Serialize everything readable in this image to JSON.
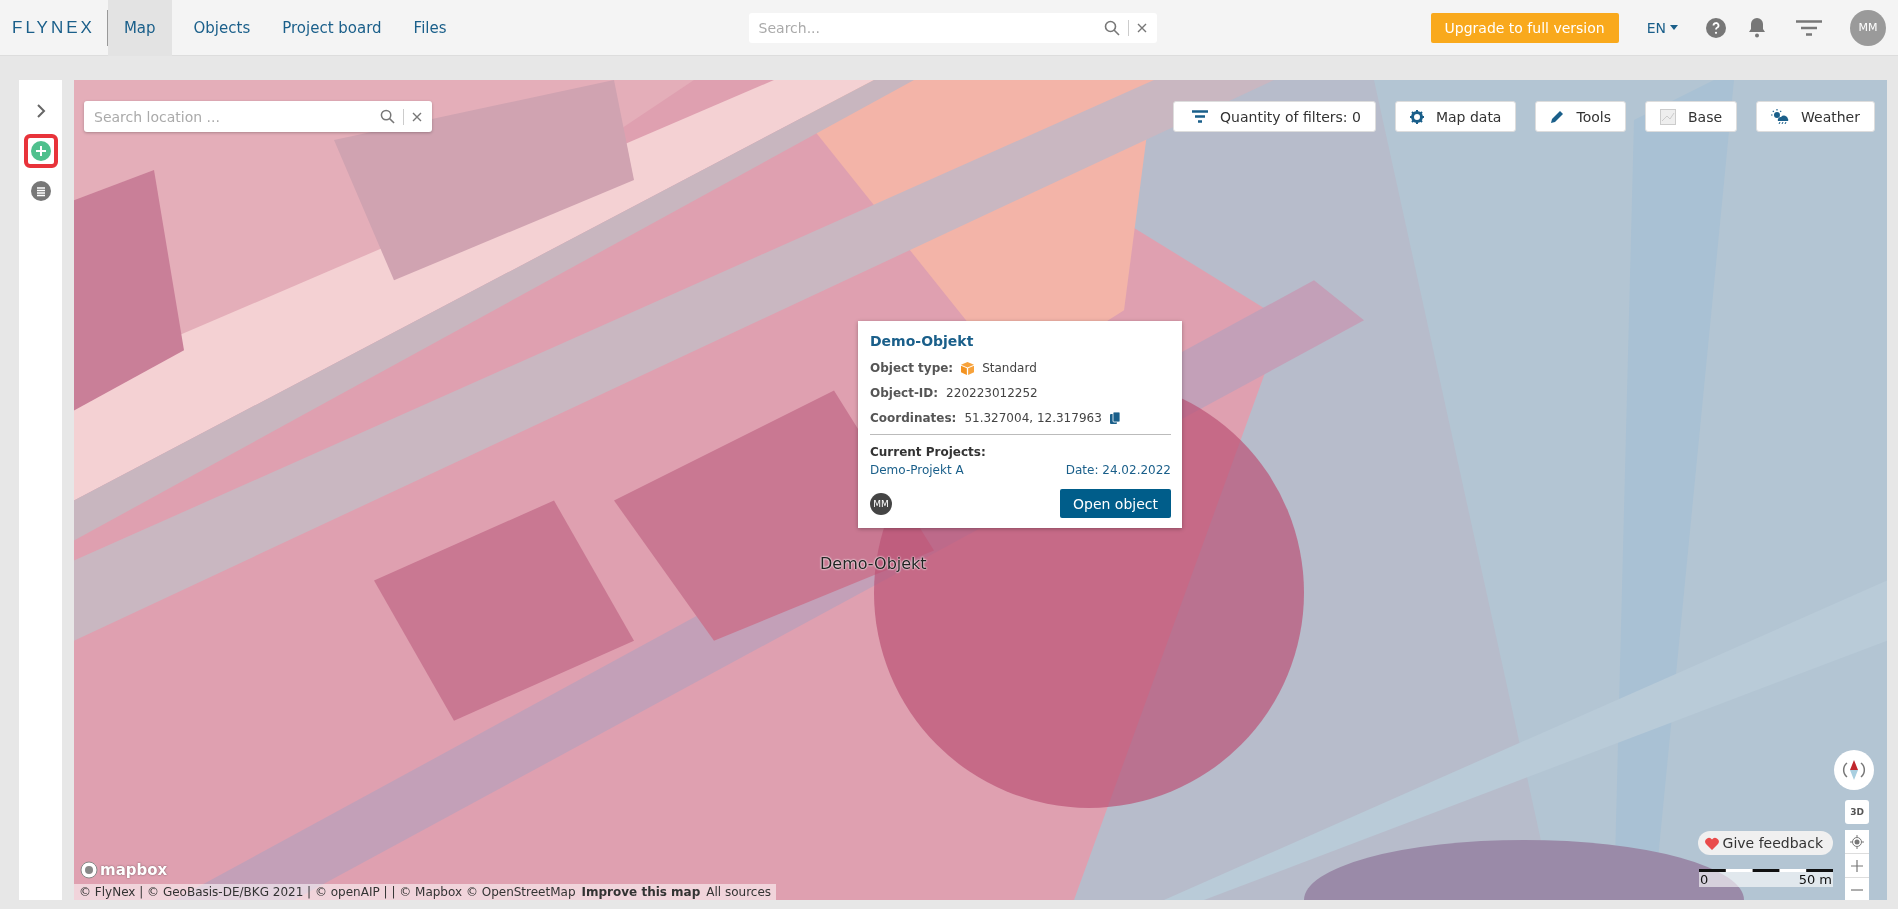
{
  "header": {
    "logo": "FLYNEX",
    "nav": [
      {
        "label": "Map",
        "selected": true
      },
      {
        "label": "Objects",
        "selected": false
      },
      {
        "label": "Project board",
        "selected": false
      },
      {
        "label": "Files",
        "selected": false
      }
    ],
    "search": {
      "placeholder": "Search..."
    },
    "upgrade": "Upgrade to full version",
    "language": "EN",
    "avatar": "MM"
  },
  "sidebar": {
    "items": [
      {
        "kind": "expand",
        "highlighted": false
      },
      {
        "kind": "add",
        "highlighted": true
      },
      {
        "kind": "list",
        "highlighted": false
      }
    ]
  },
  "map": {
    "search": {
      "placeholder": "Search location ..."
    },
    "toolbar": [
      {
        "kind": "filter",
        "label": "Quantity of filters: 0"
      },
      {
        "kind": "gear",
        "label": "Map data"
      },
      {
        "kind": "pencil",
        "label": "Tools"
      },
      {
        "kind": "base",
        "label": "Base"
      },
      {
        "kind": "weather",
        "label": "Weather"
      }
    ],
    "popup": {
      "title": "Demo-Objekt",
      "fields": [
        {
          "kind": "type",
          "label": "Object type:",
          "value": "Standard"
        },
        {
          "kind": "plain",
          "label": "Object-ID:",
          "value": "220223012252"
        },
        {
          "kind": "copy",
          "label": "Coordinates:",
          "value": "51.327004, 12.317963"
        }
      ],
      "projects_label": "Current Projects:",
      "projects": [
        {
          "name": "Demo-Projekt A",
          "date": "Date: 24.02.2022"
        }
      ],
      "avatar": "MM",
      "button": "Open object"
    },
    "marker_label": "Demo-Objekt",
    "controls": {
      "three_d": "3D"
    },
    "feedback": "Give feedback",
    "scale": {
      "start": "0",
      "end": "50 m"
    },
    "mapbox_logo": "mapbox",
    "attribution": [
      {
        "kind": "text",
        "text": "© FlyNex | © GeoBasis-DE/BKG 2021 | © openAIP | | © Mapbox © OpenStreetMap"
      },
      {
        "kind": "link",
        "text": "Improve this map"
      },
      {
        "kind": "plainlink",
        "text": "All sources"
      }
    ]
  }
}
